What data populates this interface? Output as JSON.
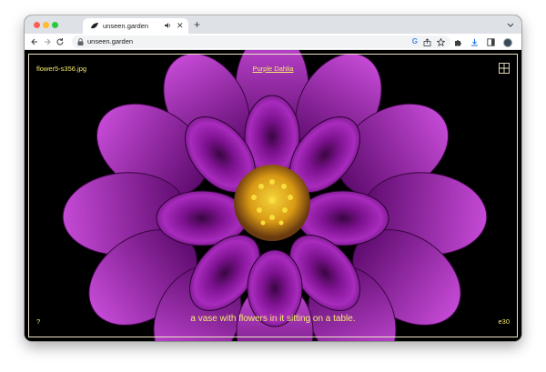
{
  "browser": {
    "tab": {
      "title": "unseen.garden",
      "close": "✕"
    },
    "new_tab": "+",
    "address": {
      "url": "unseen.garden"
    },
    "menu_glyph": "⋮"
  },
  "page": {
    "filename": "flower5-s356.jpg",
    "flower_title": "Purple Dahlia",
    "help": "?",
    "caption": "a vase with flowers in it sitting on a table.",
    "code": "e30",
    "image": {
      "subject": "purple dahlia",
      "petal_color": "#8a169e",
      "center_color": "#e8b81c"
    },
    "text_color": "#f5ec6e"
  }
}
